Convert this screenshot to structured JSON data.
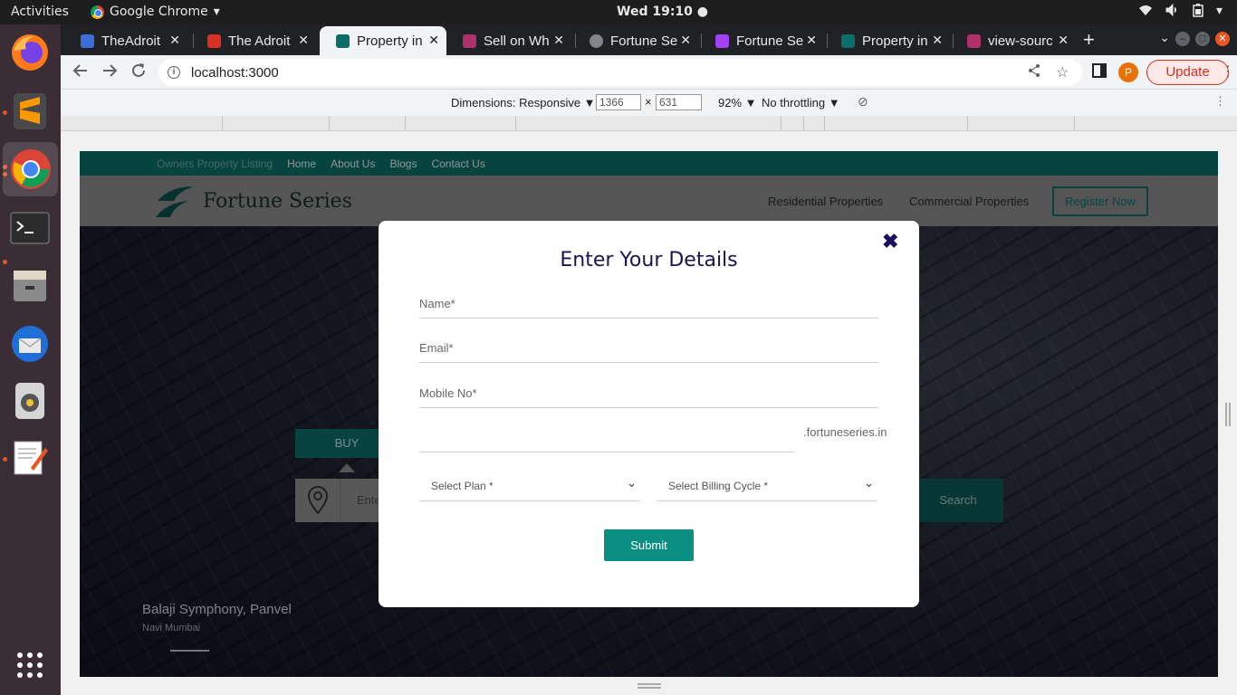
{
  "os": {
    "activities": "Activities",
    "app_name": "Google Chrome",
    "clock": "Wed 19:10 ●"
  },
  "browser": {
    "tabs": [
      {
        "label": "TheAdroit",
        "favicon_color": "#3b6ed8"
      },
      {
        "label": "The Adroit",
        "favicon_color": "#d93025"
      },
      {
        "label": "Property in",
        "favicon_color": "#0c6e68",
        "active": true
      },
      {
        "label": "Sell on Wh",
        "favicon_color": "#b0306a"
      },
      {
        "label": "Fortune Se",
        "favicon_color": "#80868b"
      },
      {
        "label": "Fortune Se",
        "favicon_color": "#a142f4"
      },
      {
        "label": "Property in",
        "favicon_color": "#0c6e68"
      },
      {
        "label": "view-sourc",
        "favicon_color": "#b0306a"
      }
    ],
    "url": "localhost:3000",
    "profile_initial": "P",
    "update_label": "Update"
  },
  "devtools": {
    "dimensions_label": "Dimensions: Responsive ▼",
    "width": "1366",
    "height": "631",
    "times": "×",
    "zoom": "92% ▼",
    "throttling": "No throttling ▼"
  },
  "site": {
    "topbar": {
      "owners_listing": "Owners Property Listing",
      "links": [
        "Home",
        "About Us",
        "Blogs",
        "Contact Us"
      ]
    },
    "logo_text": "Fortune Series",
    "nav": {
      "residential": "Residential Properties",
      "commercial": "Commercial Properties",
      "register": "Register Now"
    },
    "hero": {
      "buy_tab": "BUY",
      "search_placeholder": "Ente",
      "search_button": "Search",
      "property_name": "Balaji Symphony, Panvel",
      "property_location": "Navi Mumbai"
    }
  },
  "modal": {
    "title": "Enter Your Details",
    "fields": {
      "name": "Name*",
      "email": "Email*",
      "mobile": "Mobile No*",
      "subdomain": ""
    },
    "subdomain_suffix": ".fortuneseries.in",
    "select_plan": "Select Plan *",
    "select_billing": "Select Billing Cycle *",
    "submit": "Submit"
  },
  "colors": {
    "brand_teal": "#0c6e68",
    "submit_teal": "#0b8f82",
    "modal_title": "#1d1254",
    "update_red": "#d93025"
  }
}
